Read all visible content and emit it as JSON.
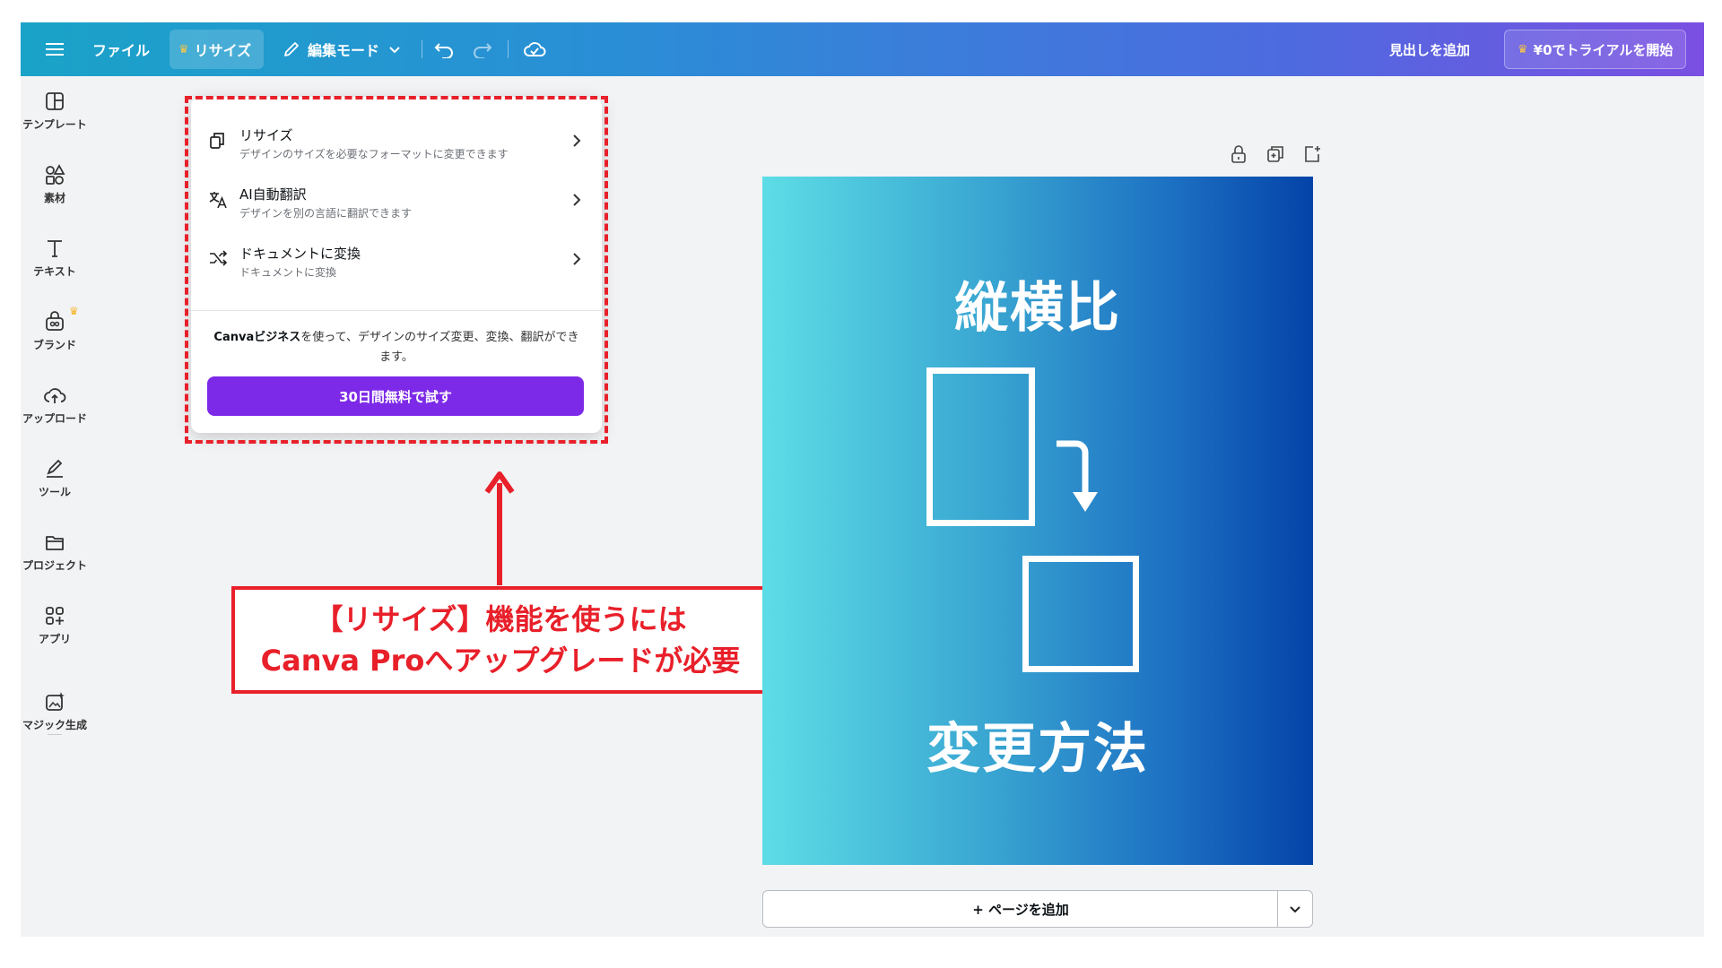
{
  "colors": {
    "annotation": "#e8202a",
    "cta": "#7d2ae8",
    "crown": "#f7c648"
  },
  "topbar": {
    "menu_icon": "hamburger-icon",
    "file_label": "ファイル",
    "resize_label": "リサイズ",
    "edit_mode_label": "編集モード",
    "add_heading_label": "見出しを追加",
    "trial_label": "¥0でトライアルを開始"
  },
  "sidebar": {
    "items": [
      {
        "label": "テンプレート",
        "icon": "template-icon"
      },
      {
        "label": "素材",
        "icon": "elements-icon"
      },
      {
        "label": "テキスト",
        "icon": "text-icon"
      },
      {
        "label": "ブランド",
        "icon": "brand-icon"
      },
      {
        "label": "アップロード",
        "icon": "upload-cloud-icon"
      },
      {
        "label": "ツール",
        "icon": "tools-icon"
      },
      {
        "label": "プロジェクト",
        "icon": "folder-icon"
      },
      {
        "label": "アプリ",
        "icon": "apps-icon"
      },
      {
        "label": "マジック生成",
        "icon": "magic-generate-icon"
      }
    ]
  },
  "dropdown": {
    "items": [
      {
        "title": "リサイズ",
        "desc": "デザインのサイズを必要なフォーマットに変更できます",
        "icon": "resize-icon"
      },
      {
        "title": "AI自動翻訳",
        "desc": "デザインを別の言語に翻訳できます",
        "icon": "translate-icon"
      },
      {
        "title": "ドキュメントに変換",
        "desc": "ドキュメントに変換",
        "icon": "convert-icon"
      }
    ],
    "message_bold": "Canvaビジネス",
    "message_rest": "を使って、デザインのサイズ変更、変換、翻訳ができます。",
    "cta_label": "30日間無料で試す"
  },
  "annotation": {
    "line1": "【リサイズ】機能を使うには",
    "line2": "Canva Proへアップグレードが必要"
  },
  "design": {
    "title": "縦横比",
    "subtitle": "変更方法"
  },
  "add_page": {
    "label": "+ ページを追加"
  }
}
